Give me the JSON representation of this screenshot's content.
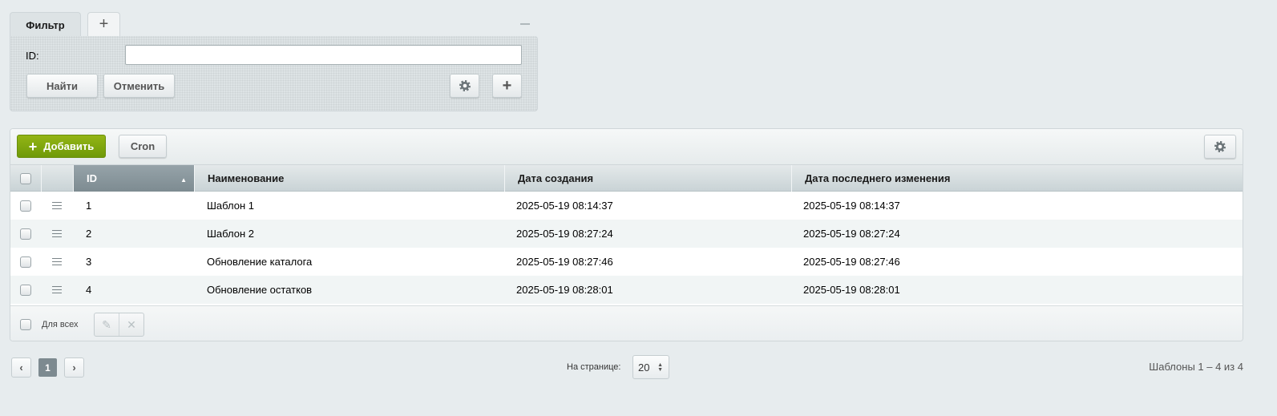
{
  "filter": {
    "tab_label": "Фильтр",
    "add_tab_icon": "plus-icon",
    "collapse_icon": "minus-icon",
    "id_label": "ID:",
    "id_value": "",
    "find_label": "Найти",
    "cancel_label": "Отменить",
    "settings_icon": "gear-icon",
    "add_field_icon": "plus-icon"
  },
  "toolbar": {
    "add_label": "Добавить",
    "add_icon": "plus-icon",
    "cron_label": "Cron",
    "settings_icon": "gear-icon",
    "add_color": "#7ba10e"
  },
  "table": {
    "columns": {
      "id": "ID",
      "name": "Наименование",
      "created": "Дата создания",
      "modified": "Дата последнего изменения"
    },
    "sort": {
      "column": "ID",
      "direction": "asc"
    },
    "rows": [
      {
        "id": "1",
        "name": "Шаблон 1",
        "created": "2025-05-19 08:14:37",
        "modified": "2025-05-19 08:14:37"
      },
      {
        "id": "2",
        "name": "Шаблон 2",
        "created": "2025-05-19 08:27:24",
        "modified": "2025-05-19 08:27:24"
      },
      {
        "id": "3",
        "name": "Обновление каталога",
        "created": "2025-05-19 08:27:46",
        "modified": "2025-05-19 08:27:46"
      },
      {
        "id": "4",
        "name": "Обновление остатков",
        "created": "2025-05-19 08:28:01",
        "modified": "2025-05-19 08:28:01"
      }
    ],
    "footer_label": "Для всех",
    "edit_icon": "pencil-icon",
    "delete_icon": "close-icon"
  },
  "pagination": {
    "prev_label": "‹",
    "next_label": "›",
    "current_page": "1",
    "per_page_label": "На странице:",
    "per_page_value": "20",
    "total_text": "Шаблоны 1 – 4 из 4"
  }
}
